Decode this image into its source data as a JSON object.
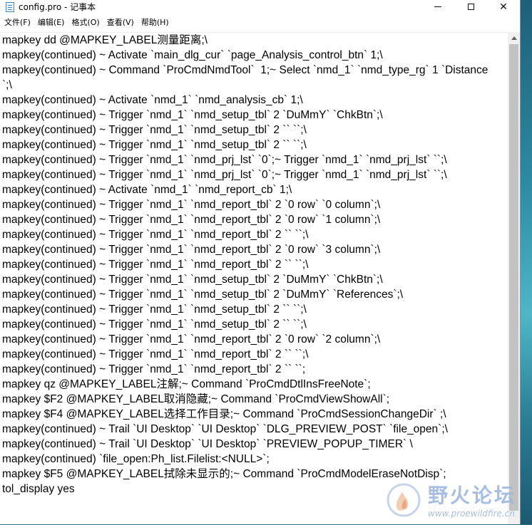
{
  "window": {
    "title": "config.pro - 记事本",
    "icon": "notepad-icon",
    "controls": [
      "minimize",
      "maximize",
      "close"
    ],
    "close_glyph": "✕"
  },
  "menu": [
    {
      "label": "文件(F)"
    },
    {
      "label": "编辑(E)"
    },
    {
      "label": "格式(O)"
    },
    {
      "label": "查看(V)"
    },
    {
      "label": "帮助(H)"
    }
  ],
  "content": {
    "lines": [
      "mapkey dd @MAPKEY_LABEL测量距离;\\",
      "mapkey(continued) ~ Activate `main_dlg_cur` `page_Analysis_control_btn` 1;\\",
      "mapkey(continued) ~ Command `ProCmdNmdTool`  1;~ Select `nmd_1` `nmd_type_rg` 1 `Distance`;\\",
      "mapkey(continued) ~ Activate `nmd_1` `nmd_analysis_cb` 1;\\",
      "mapkey(continued) ~ Trigger `nmd_1` `nmd_setup_tbl` 2 `DuMmY` `ChkBtn`;\\",
      "mapkey(continued) ~ Trigger `nmd_1` `nmd_setup_tbl` 2 `` ``;\\",
      "mapkey(continued) ~ Trigger `nmd_1` `nmd_setup_tbl` 2 `` ``;\\",
      "mapkey(continued) ~ Trigger `nmd_1` `nmd_prj_lst` `0`;~ Trigger `nmd_1` `nmd_prj_lst` ``;\\",
      "mapkey(continued) ~ Trigger `nmd_1` `nmd_prj_lst` `0`;~ Trigger `nmd_1` `nmd_prj_lst` ``;\\",
      "mapkey(continued) ~ Activate `nmd_1` `nmd_report_cb` 1;\\",
      "mapkey(continued) ~ Trigger `nmd_1` `nmd_report_tbl` 2 `0 row` `0 column`;\\",
      "mapkey(continued) ~ Trigger `nmd_1` `nmd_report_tbl` 2 `0 row` `1 column`;\\",
      "mapkey(continued) ~ Trigger `nmd_1` `nmd_report_tbl` 2 `` ``;\\",
      "mapkey(continued) ~ Trigger `nmd_1` `nmd_report_tbl` 2 `0 row` `3 column`;\\",
      "mapkey(continued) ~ Trigger `nmd_1` `nmd_report_tbl` 2 `` ``;\\",
      "mapkey(continued) ~ Trigger `nmd_1` `nmd_setup_tbl` 2 `DuMmY` `ChkBtn`;\\",
      "mapkey(continued) ~ Trigger `nmd_1` `nmd_setup_tbl` 2 `DuMmY` `References`;\\",
      "mapkey(continued) ~ Trigger `nmd_1` `nmd_setup_tbl` 2 `` ``;\\",
      "mapkey(continued) ~ Trigger `nmd_1` `nmd_setup_tbl` 2 `` ``;\\",
      "mapkey(continued) ~ Trigger `nmd_1` `nmd_report_tbl` 2 `0 row` `2 column`;\\",
      "mapkey(continued) ~ Trigger `nmd_1` `nmd_report_tbl` 2 `` ``;\\",
      "mapkey(continued) ~ Trigger `nmd_1` `nmd_report_tbl` 2 `` ``;",
      "mapkey qz @MAPKEY_LABEL注解;~ Command `ProCmdDtlInsFreeNote`;",
      "mapkey $F2 @MAPKEY_LABEL取消隐藏;~ Command `ProCmdViewShowAll`;",
      "mapkey $F4 @MAPKEY_LABEL选择工作目录;~ Command `ProCmdSessionChangeDir` ;\\",
      "mapkey(continued) ~ Trail `UI Desktop` `UI Desktop` `DLG_PREVIEW_POST` `file_open`;\\",
      "mapkey(continued) ~ Trail `UI Desktop` `UI Desktop` `PREVIEW_POPUP_TIMER` \\",
      "mapkey(continued) `file_open:Ph_list.Filelist:<NULL>`;",
      "mapkey $F5 @MAPKEY_LABEL拭除未显示的;~ Command `ProCmdModelEraseNotDisp`;",
      "tol_display yes"
    ]
  },
  "watermark": {
    "title": "野火论坛",
    "url": "www.proewildfire.cn",
    "logo": "wildfire-logo-icon"
  }
}
